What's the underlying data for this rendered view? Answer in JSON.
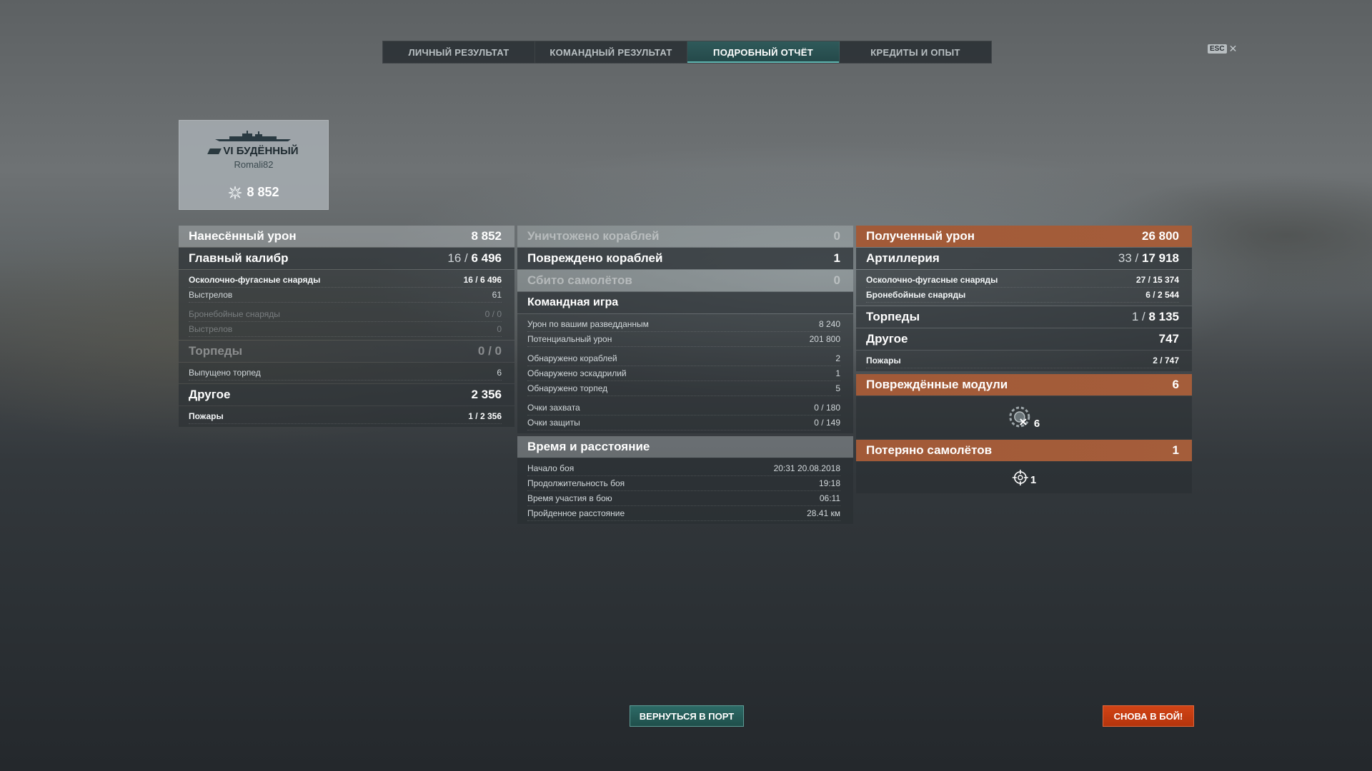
{
  "tabs": [
    {
      "label": "ЛИЧНЫЙ РЕЗУЛЬТАТ",
      "active": false
    },
    {
      "label": "КОМАНДНЫЙ РЕЗУЛЬТАТ",
      "active": false
    },
    {
      "label": "ПОДРОБНЫЙ ОТЧЁТ",
      "active": true
    },
    {
      "label": "КРЕДИТЫ И ОПЫТ",
      "active": false
    }
  ],
  "esc": {
    "key": "ESC",
    "close": "✕"
  },
  "card": {
    "ship": "VI БУДЁННЫЙ",
    "player": "Romali82",
    "damage": "8 852"
  },
  "left": {
    "dealt": {
      "label": "Нанесённый урон",
      "value": "8 852"
    },
    "main": {
      "label": "Главный калибр",
      "hits": "16",
      "dmg": "6 496"
    },
    "he": {
      "label": "Осколочно-фугасные снаряды",
      "hits": "16",
      "dmg": "6 496"
    },
    "he_shots": {
      "label": "Выстрелов",
      "value": "61"
    },
    "ap": {
      "label": "Бронебойные снаряды",
      "value": "0 / 0"
    },
    "ap_shots": {
      "label": "Выстрелов",
      "value": "0"
    },
    "torps": {
      "label": "Торпеды",
      "value": "0 / 0"
    },
    "torps_fired": {
      "label": "Выпущено торпед",
      "value": "6"
    },
    "other": {
      "label": "Другое",
      "value": "2 356"
    },
    "fires": {
      "label": "Пожары",
      "hits": "1",
      "dmg": "2 356"
    }
  },
  "middle": {
    "destroyed": {
      "label": "Уничтожено кораблей",
      "value": "0"
    },
    "damaged": {
      "label": "Повреждено кораблей",
      "value": "1"
    },
    "planes": {
      "label": "Сбито самолётов",
      "value": "0"
    },
    "team": {
      "label": "Командная игра",
      "rows": [
        {
          "label": "Урон по вашим разведданным",
          "value": "8 240"
        },
        {
          "label": "Потенциальный урон",
          "value": "201 800"
        },
        {
          "label": "Обнаружено кораблей",
          "value": "2"
        },
        {
          "label": "Обнаружено эскадрилий",
          "value": "1"
        },
        {
          "label": "Обнаружено торпед",
          "value": "5"
        },
        {
          "label": "Очки захвата",
          "value": "0 / 180"
        },
        {
          "label": "Очки защиты",
          "value": "0 / 149"
        }
      ]
    },
    "time": {
      "label": "Время и расстояние",
      "rows": [
        {
          "label": "Начало боя",
          "value": "20:31  20.08.2018"
        },
        {
          "label": "Продолжительность боя",
          "value": "19:18"
        },
        {
          "label": "Время участия в бою",
          "value": "06:11"
        },
        {
          "label": "Пройденное расстояние",
          "value": "28.41 км"
        }
      ]
    }
  },
  "right": {
    "received": {
      "label": "Полученный урон",
      "value": "26 800"
    },
    "artillery": {
      "label": "Артиллерия",
      "hits": "33",
      "dmg": "17 918"
    },
    "he": {
      "label": "Осколочно-фугасные снаряды",
      "hits": "27",
      "dmg": "15 374"
    },
    "ap": {
      "label": "Бронебойные снаряды",
      "hits": "6",
      "dmg": "2 544"
    },
    "torps": {
      "label": "Торпеды",
      "hits": "1",
      "dmg": "8 135"
    },
    "other": {
      "label": "Другое",
      "value": "747"
    },
    "fires": {
      "label": "Пожары",
      "hits": "2",
      "dmg": "747"
    },
    "modules": {
      "label": "Повреждённые модули",
      "value": "6",
      "icon_count": "6"
    },
    "planes_lost": {
      "label": "Потеряно самолётов",
      "value": "1",
      "icon_count": "1"
    }
  },
  "buttons": {
    "port": "ВЕРНУТЬСЯ В ПОРТ",
    "battle": "СНОВА В БОЙ!"
  }
}
